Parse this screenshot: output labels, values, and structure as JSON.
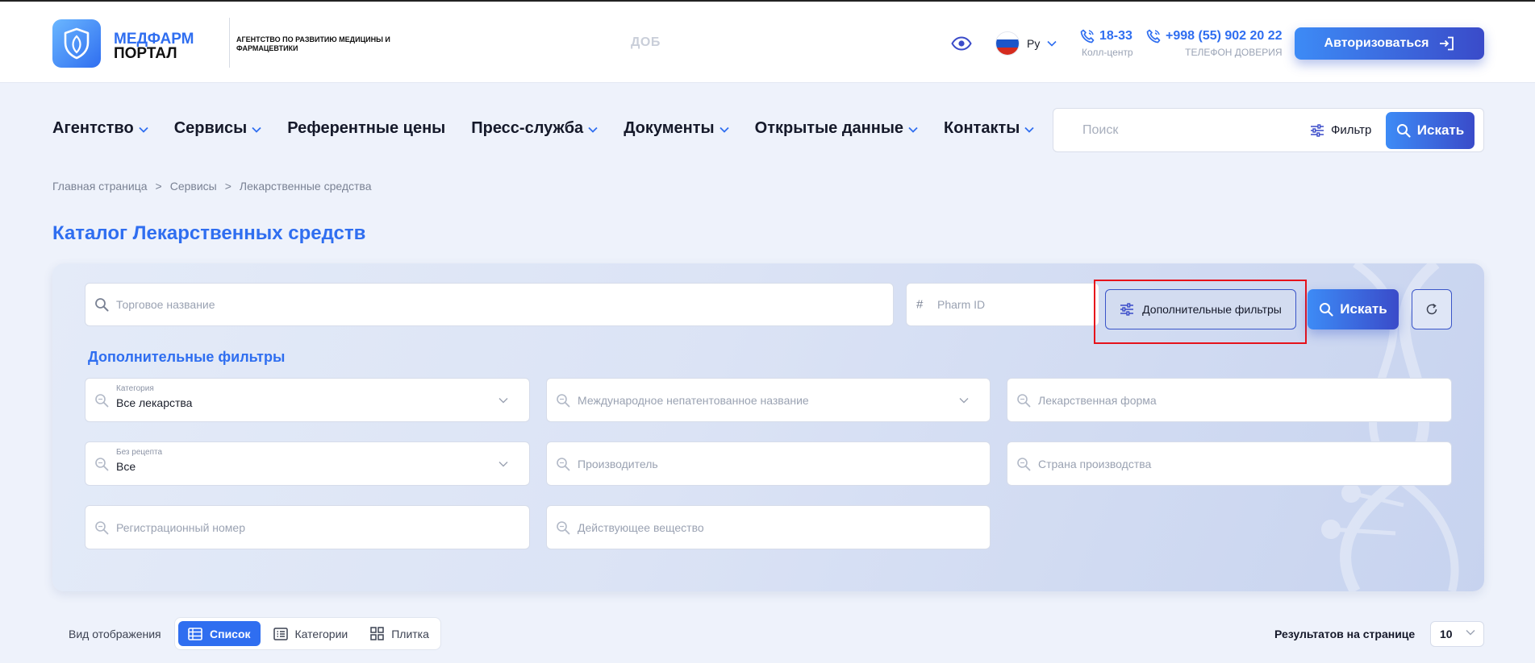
{
  "header": {
    "logo": {
      "line1": "МЕДФАРМ",
      "line2": "ПОРТАЛ"
    },
    "agency": "АГЕНТСТВО ПО РАЗВИТИЮ МЕДИЦИНЫ И ФАРМАЦЕВТИКИ",
    "marquee": "ДОБ",
    "language": "Ру",
    "phones": [
      {
        "number": "18-33",
        "caption": "Колл-центр"
      },
      {
        "number": "+998 (55) 902 20 22",
        "caption": "ТЕЛЕФОН ДОВЕРИЯ"
      }
    ],
    "auth_label": "Авторизоваться"
  },
  "nav": {
    "items": [
      {
        "label": "Агентство",
        "dropdown": true
      },
      {
        "label": "Сервисы",
        "dropdown": true
      },
      {
        "label": "Референтные цены",
        "dropdown": false
      },
      {
        "label": "Пресс-служба",
        "dropdown": true
      },
      {
        "label": "Документы",
        "dropdown": true
      },
      {
        "label": "Открытые данные",
        "dropdown": true
      },
      {
        "label": "Контакты",
        "dropdown": true
      }
    ],
    "search_placeholder": "Поиск",
    "filter_label": "Фильтр",
    "search_label": "Искать"
  },
  "breadcrumb": [
    "Главная страница",
    "Сервисы",
    "Лекарственные средства"
  ],
  "page_title": "Каталог Лекарственных средств",
  "catalog": {
    "trade_name_placeholder": "Торговое название",
    "pharm_id_placeholder": "Pharm ID",
    "more_filters_label": "Дополнительные фильтры",
    "search_label": "Искать",
    "subhead": "Дополнительные фильтры",
    "filters": {
      "category": {
        "label": "Категория",
        "value": "Все лекарства"
      },
      "inn": {
        "placeholder": "Международное непатентованное название"
      },
      "dosage_form": {
        "placeholder": "Лекарственная форма"
      },
      "otc": {
        "label": "Без рецепта",
        "value": "Все"
      },
      "manufacturer": {
        "placeholder": "Производитель"
      },
      "country": {
        "placeholder": "Страна производства"
      },
      "reg_number": {
        "placeholder": "Регистрационный номер"
      },
      "active_substance": {
        "placeholder": "Действующее вещество"
      }
    }
  },
  "view": {
    "label": "Вид отображения",
    "options": [
      {
        "label": "Список",
        "active": true
      },
      {
        "label": "Категории",
        "active": false
      },
      {
        "label": "Плитка",
        "active": false
      }
    ]
  },
  "pagination": {
    "per_page_label": "Результатов на странице",
    "per_page_value": "10"
  },
  "colors": {
    "accent": "#2f6ef0",
    "accent_dark": "#3a4bc9",
    "highlight": "#e6121b"
  }
}
